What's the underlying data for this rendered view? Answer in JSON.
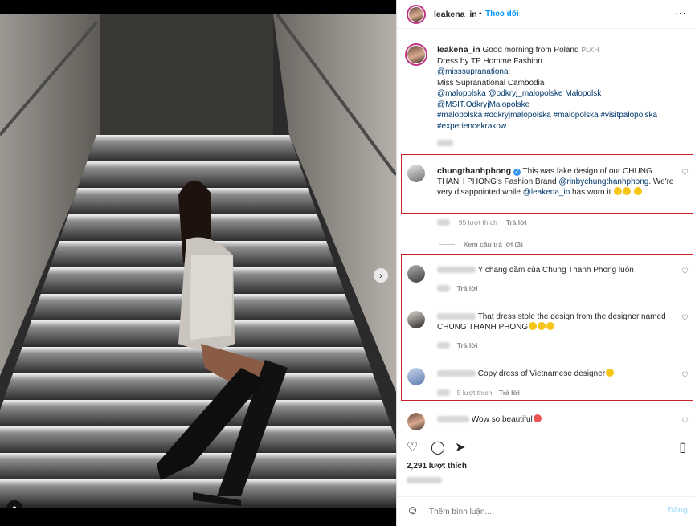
{
  "post": {
    "username": "leakena_in",
    "follow_label": "Theo dõi",
    "caption_lines": [
      "Good morning from Poland",
      "Dress by TP Homme Fashion",
      "@misssupranational",
      "Miss Supranational Cambodia",
      "@malopolska @odkryj_malopolske Małopolsk",
      "@MSIT.OdkryjMalopolske",
      "#malopolska #odkryjmalopolska #malopolska #visitpalopolska",
      "#experiencekrakow"
    ],
    "flag": "PLKH"
  },
  "comments": [
    {
      "username": "chungthanhphong",
      "verified": true,
      "text_a": "This was fake design of our CHUNG THANH PHONG's Fashion Brand",
      "mention": "@rinbychungthanhphong",
      "text_b": ". We're very disappointed while",
      "mention2": "@leakena_in",
      "text_c": "has worn it",
      "likes": "95 lượt thích",
      "reply": "Trả lời",
      "view_replies": "Xem câu trả lời (3)"
    },
    {
      "text": "Y chang đầm của Chung Thanh Phong luôn",
      "reply": "Trả lời"
    },
    {
      "text": "That dress stole the design from the designer named CHUNG THANH PHONG",
      "reply": "Trả lời"
    },
    {
      "text": "Copy dress of Vietnamese designer",
      "likes": "5 lượt thích",
      "reply": "Trả lời"
    },
    {
      "text": "Wow so beautiful"
    }
  ],
  "footer": {
    "likes": "2,291 lượt thích",
    "add_comment_placeholder": "Thêm bình luận...",
    "post_button": "Đăng"
  },
  "icons": [
    "heart-icon",
    "comment-icon",
    "share-icon",
    "bookmark-icon",
    "emoji-icon",
    "next-arrow-icon",
    "user-tag-icon",
    "verified-icon"
  ],
  "colors": {
    "link": "#00376b",
    "follow": "#0095f6",
    "highlight_box": "#c8232c"
  }
}
